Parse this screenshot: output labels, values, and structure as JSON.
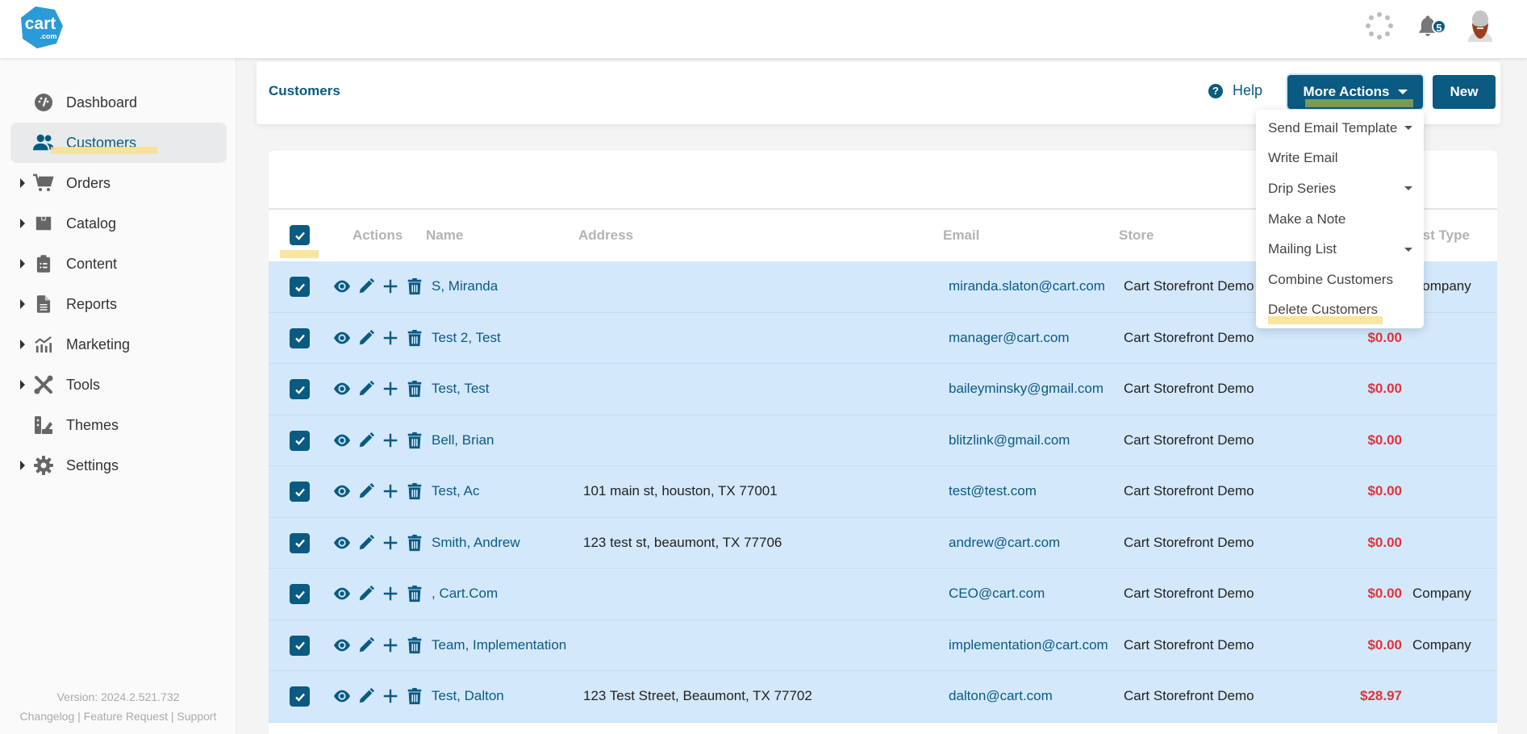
{
  "app": {
    "brand": "cart",
    "brand_sub": ".com"
  },
  "topbar": {
    "notification_count": "5"
  },
  "sidebar": {
    "items": [
      {
        "label": "Dashboard",
        "icon": "dashboard-icon",
        "expandable": false,
        "active": false
      },
      {
        "label": "Customers",
        "icon": "users-icon",
        "expandable": false,
        "active": true
      },
      {
        "label": "Orders",
        "icon": "cart-icon",
        "expandable": true,
        "active": false
      },
      {
        "label": "Catalog",
        "icon": "box-icon",
        "expandable": true,
        "active": false
      },
      {
        "label": "Content",
        "icon": "clipboard-icon",
        "expandable": true,
        "active": false
      },
      {
        "label": "Reports",
        "icon": "file-icon",
        "expandable": true,
        "active": false
      },
      {
        "label": "Marketing",
        "icon": "chart-icon",
        "expandable": true,
        "active": false
      },
      {
        "label": "Tools",
        "icon": "tools-icon",
        "expandable": true,
        "active": false
      },
      {
        "label": "Themes",
        "icon": "swatches-icon",
        "expandable": false,
        "active": false
      },
      {
        "label": "Settings",
        "icon": "gear-icon",
        "expandable": true,
        "active": false
      }
    ],
    "version": "Version: 2024.2.521.732",
    "links": [
      "Changelog",
      "Feature Request",
      "Support"
    ],
    "link_sep": " | "
  },
  "header": {
    "title": "Customers",
    "help_label": "Help",
    "more_actions_label": "More Actions",
    "new_label": "New"
  },
  "more_actions_menu": [
    {
      "label": "Send Email Template",
      "submenu": true
    },
    {
      "label": "Write Email",
      "submenu": false
    },
    {
      "label": "Drip Series",
      "submenu": true
    },
    {
      "label": "Make a Note",
      "submenu": false
    },
    {
      "label": "Mailing List",
      "submenu": true
    },
    {
      "label": "Combine Customers",
      "submenu": false
    },
    {
      "label": "Delete Customers",
      "submenu": false
    }
  ],
  "table": {
    "columns": {
      "actions": "Actions",
      "name": "Name",
      "address": "Address",
      "email": "Email",
      "store": "Store",
      "cust_type": "Cust Type"
    },
    "select_all_checked": true,
    "rows": [
      {
        "checked": true,
        "name": "S, Miranda",
        "address": "",
        "email": "miranda.slaton@cart.com",
        "store": "Cart Storefront Demo",
        "balance": "",
        "cust_type": "Company"
      },
      {
        "checked": true,
        "name": "Test 2, Test",
        "address": "",
        "email": "manager@cart.com",
        "store": "Cart Storefront Demo",
        "balance": "$0.00",
        "cust_type": ""
      },
      {
        "checked": true,
        "name": "Test, Test",
        "address": "",
        "email": "baileyminsky@gmail.com",
        "store": "Cart Storefront Demo",
        "balance": "$0.00",
        "cust_type": ""
      },
      {
        "checked": true,
        "name": "Bell, Brian",
        "address": "",
        "email": "blitzlink@gmail.com",
        "store": "Cart Storefront Demo",
        "balance": "$0.00",
        "cust_type": ""
      },
      {
        "checked": true,
        "name": "Test, Ac",
        "address": "101 main st, houston, TX 77001",
        "email": "test@test.com",
        "store": "Cart Storefront Demo",
        "balance": "$0.00",
        "cust_type": ""
      },
      {
        "checked": true,
        "name": "Smith, Andrew",
        "address": "123 test st, beaumont, TX 77706",
        "email": "andrew@cart.com",
        "store": "Cart Storefront Demo",
        "balance": "$0.00",
        "cust_type": ""
      },
      {
        "checked": true,
        "name": ", Cart.Com",
        "address": "",
        "email": "CEO@cart.com",
        "store": "Cart Storefront Demo",
        "balance": "$0.00",
        "cust_type": "Company"
      },
      {
        "checked": true,
        "name": "Team, Implementation",
        "address": "",
        "email": "implementation@cart.com",
        "store": "Cart Storefront Demo",
        "balance": "$0.00",
        "cust_type": "Company"
      },
      {
        "checked": true,
        "name": "Test, Dalton",
        "address": "123 Test Street, Beaumont, TX 77702",
        "email": "dalton@cart.com",
        "store": "Cart Storefront Demo",
        "balance": "$28.97",
        "cust_type": ""
      }
    ]
  },
  "colors": {
    "primary": "#0a5a82",
    "brand_blue": "#2b9ad8",
    "row_selected": "#d3e8fb",
    "negative": "#e2333b",
    "highlight": "#f7e28f"
  }
}
